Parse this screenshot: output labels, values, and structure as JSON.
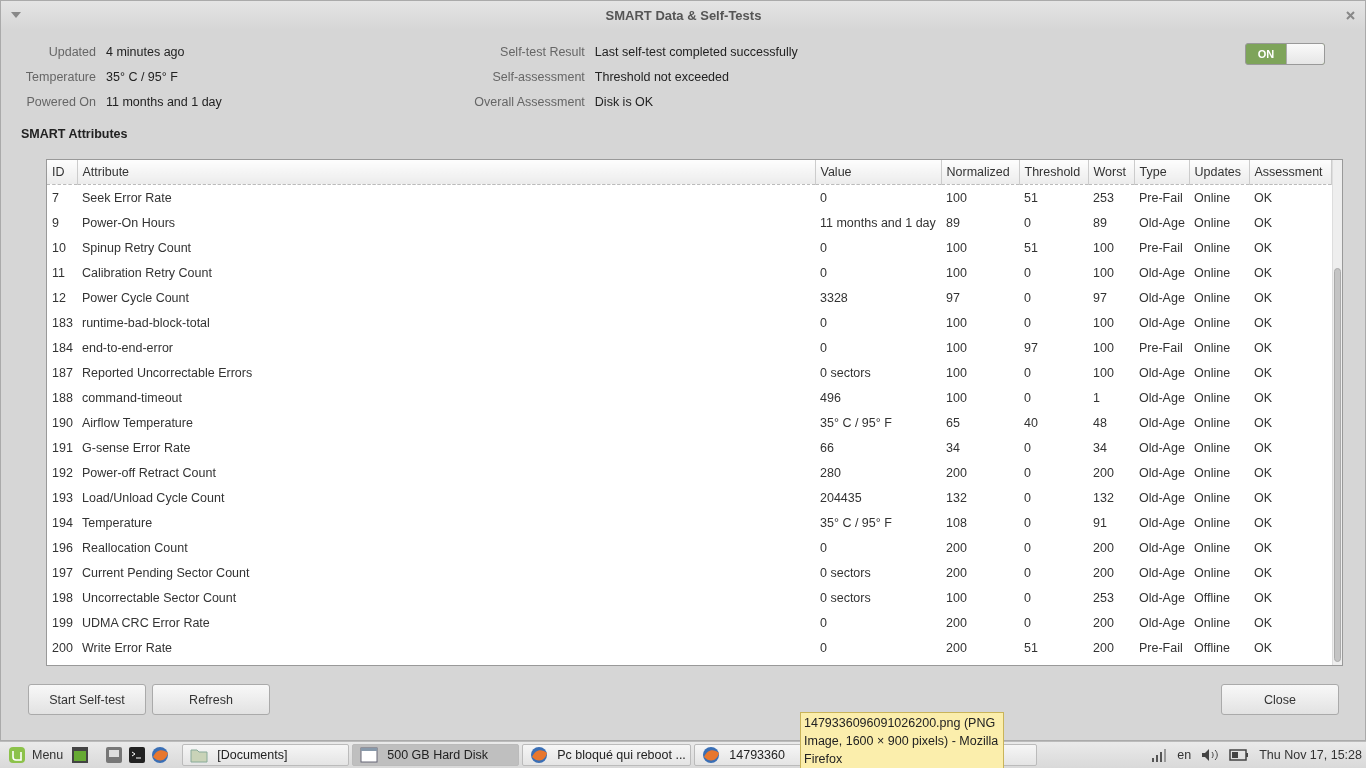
{
  "window": {
    "title": "SMART Data & Self-Tests"
  },
  "info_left": [
    {
      "label": "Updated",
      "value": "4 minutes ago"
    },
    {
      "label": "Temperature",
      "value": "35° C / 95° F"
    },
    {
      "label": "Powered On",
      "value": "11 months and 1 day"
    }
  ],
  "info_right": [
    {
      "label": "Self-test Result",
      "value": "Last self-test completed successfully"
    },
    {
      "label": "Self-assessment",
      "value": "Threshold not exceeded"
    },
    {
      "label": "Overall Assessment",
      "value": "Disk is OK"
    }
  ],
  "toggle": {
    "label": "ON",
    "on": true
  },
  "section_title": "SMART Attributes",
  "table": {
    "columns": [
      "ID",
      "Attribute",
      "Value",
      "Normalized",
      "Threshold",
      "Worst",
      "Type",
      "Updates",
      "Assessment"
    ],
    "rows": [
      [
        "7",
        "Seek Error Rate",
        "0",
        "100",
        "51",
        "253",
        "Pre-Fail",
        "Online",
        "OK"
      ],
      [
        "9",
        "Power-On Hours",
        "11 months and 1 day",
        "89",
        "0",
        "89",
        "Old-Age",
        "Online",
        "OK"
      ],
      [
        "10",
        "Spinup Retry Count",
        "0",
        "100",
        "51",
        "100",
        "Pre-Fail",
        "Online",
        "OK"
      ],
      [
        "11",
        "Calibration Retry Count",
        "0",
        "100",
        "0",
        "100",
        "Old-Age",
        "Online",
        "OK"
      ],
      [
        "12",
        "Power Cycle Count",
        "3328",
        "97",
        "0",
        "97",
        "Old-Age",
        "Online",
        "OK"
      ],
      [
        "183",
        "runtime-bad-block-total",
        "0",
        "100",
        "0",
        "100",
        "Old-Age",
        "Online",
        "OK"
      ],
      [
        "184",
        "end-to-end-error",
        "0",
        "100",
        "97",
        "100",
        "Pre-Fail",
        "Online",
        "OK"
      ],
      [
        "187",
        "Reported Uncorrectable Errors",
        "0 sectors",
        "100",
        "0",
        "100",
        "Old-Age",
        "Online",
        "OK"
      ],
      [
        "188",
        "command-timeout",
        "496",
        "100",
        "0",
        "1",
        "Old-Age",
        "Online",
        "OK"
      ],
      [
        "190",
        "Airflow Temperature",
        "35° C / 95° F",
        "65",
        "40",
        "48",
        "Old-Age",
        "Online",
        "OK"
      ],
      [
        "191",
        "G-sense Error Rate",
        "66",
        "34",
        "0",
        "34",
        "Old-Age",
        "Online",
        "OK"
      ],
      [
        "192",
        "Power-off Retract Count",
        "280",
        "200",
        "0",
        "200",
        "Old-Age",
        "Online",
        "OK"
      ],
      [
        "193",
        "Load/Unload Cycle Count",
        "204435",
        "132",
        "0",
        "132",
        "Old-Age",
        "Online",
        "OK"
      ],
      [
        "194",
        "Temperature",
        "35° C / 95° F",
        "108",
        "0",
        "91",
        "Old-Age",
        "Online",
        "OK"
      ],
      [
        "196",
        "Reallocation Count",
        "0",
        "200",
        "0",
        "200",
        "Old-Age",
        "Online",
        "OK"
      ],
      [
        "197",
        "Current Pending Sector Count",
        "0 sectors",
        "200",
        "0",
        "200",
        "Old-Age",
        "Online",
        "OK"
      ],
      [
        "198",
        "Uncorrectable Sector Count",
        "0 sectors",
        "100",
        "0",
        "253",
        "Old-Age",
        "Offline",
        "OK"
      ],
      [
        "199",
        "UDMA CRC Error Rate",
        "0",
        "200",
        "0",
        "200",
        "Old-Age",
        "Online",
        "OK"
      ],
      [
        "200",
        "Write Error Rate",
        "0",
        "200",
        "51",
        "200",
        "Pre-Fail",
        "Offline",
        "OK"
      ]
    ]
  },
  "buttons_left": [
    "Start Self-test",
    "Refresh"
  ],
  "button_right": "Close",
  "taskbar": {
    "menu": "Menu",
    "windows": [
      {
        "label": "[Documents]",
        "selected": false,
        "kind": "folder"
      },
      {
        "label": "500 GB Hard Disk",
        "selected": true,
        "kind": "window"
      },
      {
        "label": "Pc bloqué qui reboot ...",
        "selected": false,
        "kind": "browser"
      },
      {
        "label": "14793360",
        "selected": false,
        "kind": "browser"
      }
    ],
    "language": "en",
    "clock": "Thu Nov 17, 15:28"
  },
  "tooltip": "1479336096091026200.png (PNG Image, 1600 × 900 pixels) - Mozilla Firefox"
}
